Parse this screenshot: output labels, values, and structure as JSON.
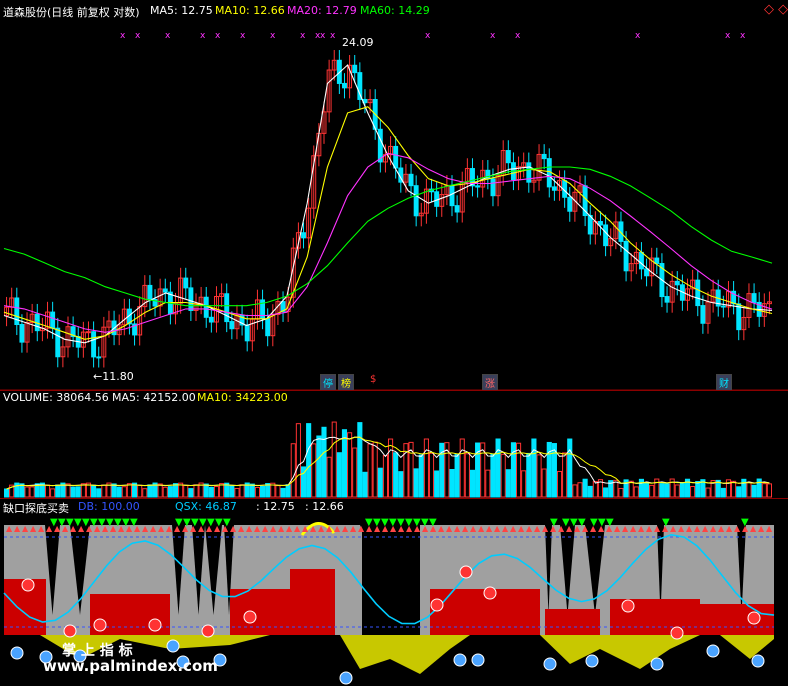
{
  "header": {
    "stock": "道森股份(日线 前复权 对数)",
    "ma5": "MA5: 12.75",
    "ma10": "MA10: 12.66",
    "ma20": "MA20: 12.79",
    "ma60": "MA60: 14.29",
    "nav_icon": "diamond-icon"
  },
  "price_panel": {
    "high_marker": "24.09",
    "low_marker": "←11.80",
    "badges": [
      "停",
      "榜",
      "$",
      "涨",
      "财"
    ]
  },
  "volume_panel": {
    "title": "VOLUME: 38064.56",
    "ma5": "MA5: 42152.00",
    "ma10": "MA10: 34223.00"
  },
  "indicator_panel": {
    "title": "缺口探底买卖",
    "db": "DB: 100.00",
    "qsx": "QSX: 46.87",
    "pair": ": 12.75",
    "value": ": 12.66"
  },
  "watermark": {
    "name": "掌 上 指 标",
    "url": "www.palmindex.com"
  },
  "colors": {
    "background": "#000000",
    "up": "#ff3333",
    "down": "#00e5ff",
    "ma5": "#ffffff",
    "ma10": "#ffff00",
    "ma20": "#ff33ff",
    "ma60": "#00ff00",
    "qsx": "#00ccff"
  },
  "chart_data": [
    {
      "type": "line",
      "title": "道森股份(日线 前复权 对数)",
      "series": [
        {
          "name": "MA5",
          "values": [
            12.6,
            12.4,
            12.2,
            11.9,
            11.8,
            12.0,
            12.5,
            13.0,
            13.3,
            13.1,
            12.9,
            12.6,
            12.3,
            12.5,
            13.2,
            16.5,
            22.0,
            23.0,
            20.5,
            18.5,
            17.0,
            16.5,
            16.8,
            17.2,
            17.6,
            17.9,
            18.0,
            17.6,
            16.8,
            16.0,
            15.2,
            14.6,
            14.0,
            13.5,
            13.2,
            13.0,
            12.9,
            12.8,
            12.75
          ]
        },
        {
          "name": "MA10",
          "values": [
            12.7,
            12.5,
            12.3,
            12.1,
            11.9,
            12.0,
            12.3,
            12.7,
            13.0,
            13.0,
            12.9,
            12.7,
            12.5,
            12.5,
            12.8,
            14.5,
            18.0,
            20.5,
            20.8,
            19.8,
            18.5,
            17.5,
            17.2,
            17.3,
            17.5,
            17.7,
            17.9,
            17.8,
            17.3,
            16.5,
            15.8,
            15.0,
            14.4,
            13.9,
            13.5,
            13.2,
            13.0,
            12.8,
            12.66
          ]
        },
        {
          "name": "MA20",
          "values": [
            12.9,
            12.8,
            12.6,
            12.4,
            12.2,
            12.1,
            12.2,
            12.4,
            12.6,
            12.8,
            12.8,
            12.7,
            12.6,
            12.6,
            12.7,
            13.5,
            15.0,
            16.8,
            18.0,
            18.6,
            18.4,
            17.9,
            17.5,
            17.3,
            17.3,
            17.4,
            17.5,
            17.6,
            17.5,
            17.1,
            16.6,
            16.0,
            15.4,
            14.8,
            14.2,
            13.7,
            13.3,
            13.0,
            12.79
          ]
        },
        {
          "name": "MA60",
          "values": [
            14.8,
            14.6,
            14.3,
            14.0,
            13.8,
            13.5,
            13.3,
            13.1,
            13.0,
            12.9,
            12.9,
            12.9,
            12.9,
            13.0,
            13.2,
            13.6,
            14.2,
            15.0,
            15.8,
            16.3,
            16.7,
            17.0,
            17.2,
            17.4,
            17.6,
            17.8,
            17.9,
            18.0,
            18.0,
            17.9,
            17.6,
            17.2,
            16.7,
            16.2,
            15.6,
            15.1,
            14.7,
            14.5,
            14.29
          ]
        }
      ],
      "price_range": [
        11.8,
        24.09
      ],
      "log_scale": true
    },
    {
      "type": "bar",
      "title": "VOLUME",
      "values": [
        38064.56
      ],
      "series": [
        {
          "name": "MA5",
          "values": [
            42152.0
          ]
        },
        {
          "name": "MA10",
          "values": [
            34223.0
          ]
        }
      ]
    },
    {
      "type": "area",
      "title": "缺口探底买卖",
      "series": [
        {
          "name": "DB",
          "values": [
            100.0
          ]
        },
        {
          "name": "QSX",
          "values": [
            46.87
          ]
        }
      ]
    }
  ]
}
